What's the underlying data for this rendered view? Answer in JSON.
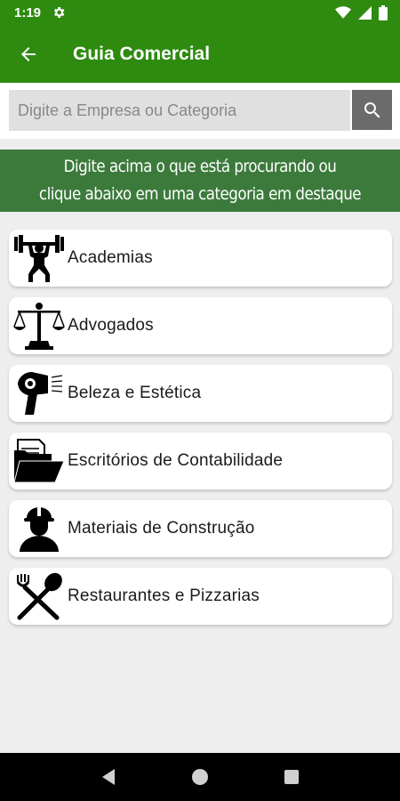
{
  "status_bar": {
    "time": "1:19",
    "icons": [
      "gear-icon",
      "wifi-icon",
      "signal-icon",
      "battery-icon"
    ]
  },
  "app_bar": {
    "title": "Guia Comercial",
    "back_icon": "arrow-left-icon"
  },
  "search": {
    "placeholder": "Digite a Empresa ou Categoria",
    "value": "",
    "button_icon": "search-icon"
  },
  "banner": {
    "line1": "Digite acima o que está procurando ou",
    "line2": "clique abaixo em uma categoria em destaque"
  },
  "categories": [
    {
      "label": "Academias",
      "icon": "weightlifter-icon"
    },
    {
      "label": "Advogados",
      "icon": "scales-of-justice-icon"
    },
    {
      "label": "Beleza e Estética",
      "icon": "hair-dryer-icon"
    },
    {
      "label": "Escritórios de Contabilidade",
      "icon": "folder-documents-icon"
    },
    {
      "label": "Materiais de Construção",
      "icon": "construction-worker-icon"
    },
    {
      "label": "Restaurantes e Pizzarias",
      "icon": "fork-spoon-icon"
    }
  ],
  "nav_bar": {
    "buttons": [
      "back-triangle-icon",
      "home-circle-icon",
      "recents-square-icon"
    ]
  },
  "colors": {
    "primary": "#2e8b10",
    "banner": "#3c7a3c",
    "search_button": "#6b6b6b",
    "background": "#eeeeee"
  }
}
